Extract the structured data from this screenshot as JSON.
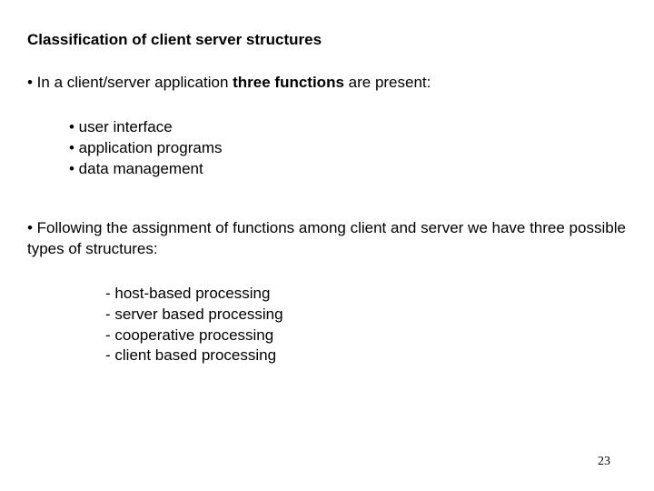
{
  "title": "Classification of client server structures",
  "bullet1_pre": "• In a client/server application ",
  "bullet1_bold": "three functions",
  "bullet1_post": " are present:",
  "functions": [
    "• user interface",
    "• application programs",
    "• data management"
  ],
  "bullet2": "• Following the assignment of functions among client and server we have three possible types of structures:",
  "structures": [
    "- host-based processing",
    "- server based processing",
    "- cooperative processing",
    "- client based processing"
  ],
  "page_number": "23"
}
